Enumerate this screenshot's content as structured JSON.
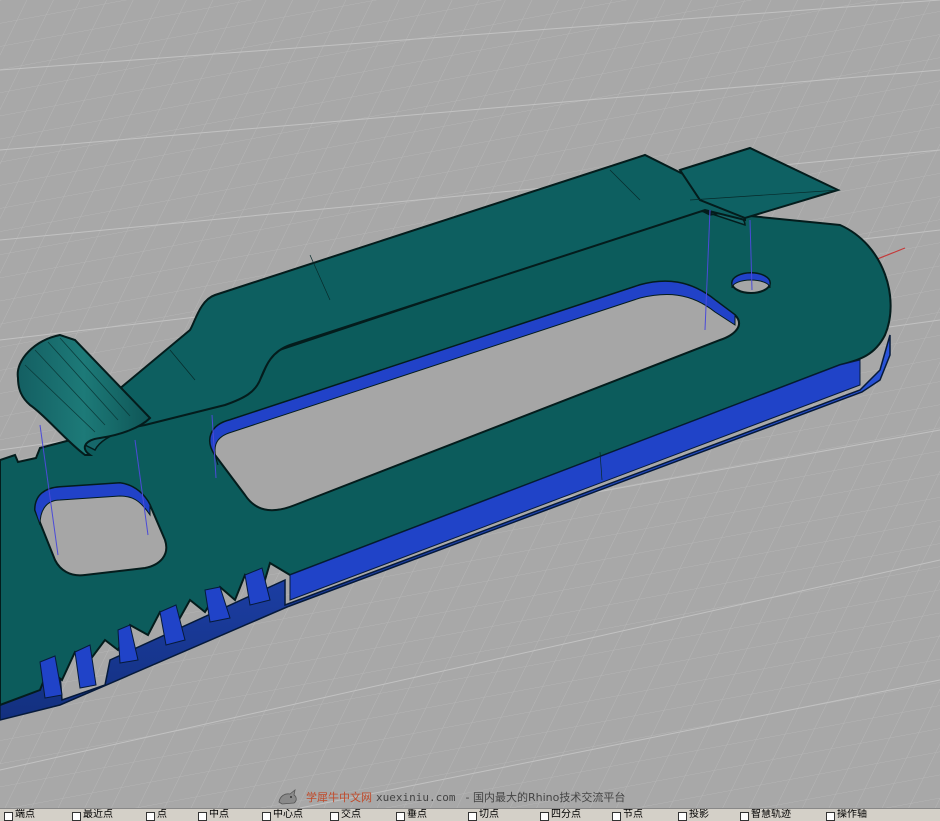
{
  "viewport": {
    "background": "#a8a8a8",
    "grid_color": "#b9b9b9",
    "axis_x_color": "#c43a3a",
    "model_top_color": "#0c5c5c",
    "model_side_color": "#1d3fbf",
    "icon": "rhino-viewport"
  },
  "watermark": {
    "logo_icon": "rhino-logo-icon",
    "brand": "学犀牛中文网",
    "site": "xuexiniu.com",
    "tagline": "- 国内最大的Rhino技术交流平台"
  },
  "statusbar": {
    "snaps": [
      "端点",
      "最近点",
      "点",
      "中点",
      "中心点",
      "交点",
      "垂点",
      "切点",
      "四分点",
      "节点",
      "投影",
      "智慧轨迹",
      "操作轴"
    ]
  }
}
